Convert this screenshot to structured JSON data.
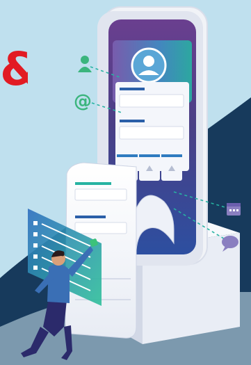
{
  "headline": {
    "visible_fragment": "&",
    "color": "#e21b23"
  },
  "colors": {
    "sky": "#bfe0ee",
    "navy": "#173a5c",
    "phone_body": "#f1f3f7",
    "phone_screen": "#4a3f86",
    "accent_teal": "#27b3a2",
    "accent_blue": "#2f7bc0",
    "form_blue": "#2b5fa8",
    "person_shirt": "#3a6fb5",
    "person_pants": "#2b2a6b",
    "person_hair": "#2b1b1b",
    "cap_green": "#3cc27a"
  },
  "icons": [
    {
      "name": "user-icon",
      "color": "#3bb57d"
    },
    {
      "name": "at-sign-icon",
      "color": "#3bb57d"
    },
    {
      "name": "calendar-icon",
      "color": "#8a7fc0"
    },
    {
      "name": "chat-bubble-icon",
      "color": "#8a7fc0"
    }
  ]
}
